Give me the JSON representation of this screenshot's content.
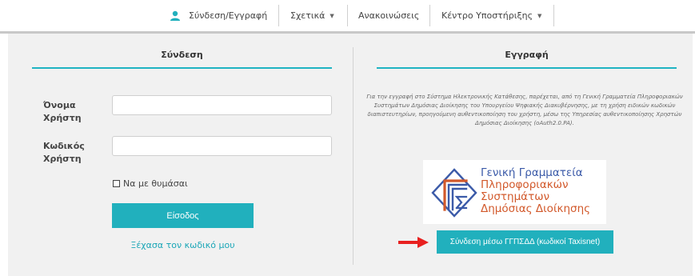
{
  "nav": {
    "login_register": "Σύνδεση/Εγγραφή",
    "about": "Σχετικά",
    "announcements": "Ανακοινώσεις",
    "support": "Κέντρο Υποστήριξης"
  },
  "login": {
    "title": "Σύνδεση",
    "username_label": "Όνομα Χρήστη",
    "password_label": "Κωδικός Χρήστη",
    "username_value": "",
    "password_value": "",
    "remember_label": "Να με θυμάσαι",
    "submit_label": "Είσοδος",
    "forgot_label": "Ξέχασα τον κωδικό μου"
  },
  "register": {
    "title": "Εγγραφή",
    "info": "Για την εγγραφή στο Σύστημα Ηλεκτρονικής Κατάθεσης, παρέχεται, από τη Γενική Γραμματεία Πληροφοριακών Συστημάτων Δημόσιας Διοίκησης του Υπουργείου Ψηφιακής Διακυβέρνησης, με τη χρήση ειδικών κωδικών διαπιστευτηρίων, προηγούμενη αυθεντικοποίηση του χρήστη, μέσω της Υπηρεσίας αυθεντικοποίησης Χρηστών Δημόσιας Διοίκησης (oAuth2.0.PA).",
    "logo_line1": "Γενική Γραμματεία",
    "logo_line2": "Πληροφοριακών",
    "logo_line3": "Συστημάτων",
    "logo_line4": "Δημόσιας Διοίκησης",
    "gsis_button": "Σύνδεση μέσω ΓΓΠΣΔΔ (κωδικοί Taxisnet)"
  },
  "colors": {
    "accent": "#21b0bd",
    "logo_blue": "#3b5aa8",
    "logo_orange": "#d2592b",
    "arrow": "#e8201f"
  },
  "icons": {
    "user": "user-icon",
    "caret": "caret-down-icon",
    "checkbox": "checkbox-icon",
    "arrow": "arrow-right-icon"
  }
}
